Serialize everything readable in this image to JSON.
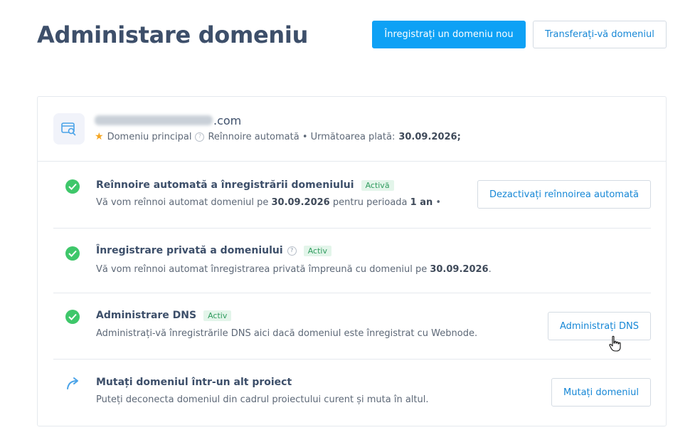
{
  "header": {
    "title": "Administare domeniu",
    "register_button": "Înregistrați un domeniu nou",
    "transfer_button": "Transferați-vă domeniul"
  },
  "domain": {
    "name_suffix": ".com",
    "name_prefix_blurred": true,
    "primary_label": "Domeniu principal",
    "renewal_text": "Reînnoire automată • Următoarea plată:",
    "next_payment_date": "30.09.2026;"
  },
  "rows": [
    {
      "title": "Reînnoire automată a înregistrării domeniului",
      "badge": "Activă",
      "desc_pre": "Vă vom reînnoi automat domeniul pe ",
      "desc_date": "30.09.2026",
      "desc_mid": " pentru perioada ",
      "desc_period": "1 an",
      "desc_post": " •",
      "button": "Dezactivați reînnoirea automată",
      "icon": "check-circle-icon"
    },
    {
      "title": "Înregistrare privată a domeniului",
      "badge": "Activ",
      "desc_pre": "Vă vom reînnoi automat înregistrarea privată împreună cu domeniul pe ",
      "desc_date": "30.09.2026",
      "desc_post": ".",
      "icon": "check-circle-icon"
    },
    {
      "title": "Administrare DNS",
      "badge": "Activ",
      "desc": "Administrați-vă înregistrările DNS aici dacă domeniul este înregistrat cu Webnode.",
      "button": "Administrați DNS",
      "icon": "check-circle-icon"
    },
    {
      "title": "Mutați domeniul într-un alt proiect",
      "desc": "Puteți deconecta domeniul din cadrul proiectului curent și muta în altul.",
      "button": "Mutați domeniul",
      "icon": "curved-arrow-icon"
    }
  ],
  "colors": {
    "primary": "#0ea1f5",
    "link": "#1687d6",
    "success": "#3ec76a",
    "badge_bg": "#e3f5ea",
    "title": "#3d4f6a"
  }
}
